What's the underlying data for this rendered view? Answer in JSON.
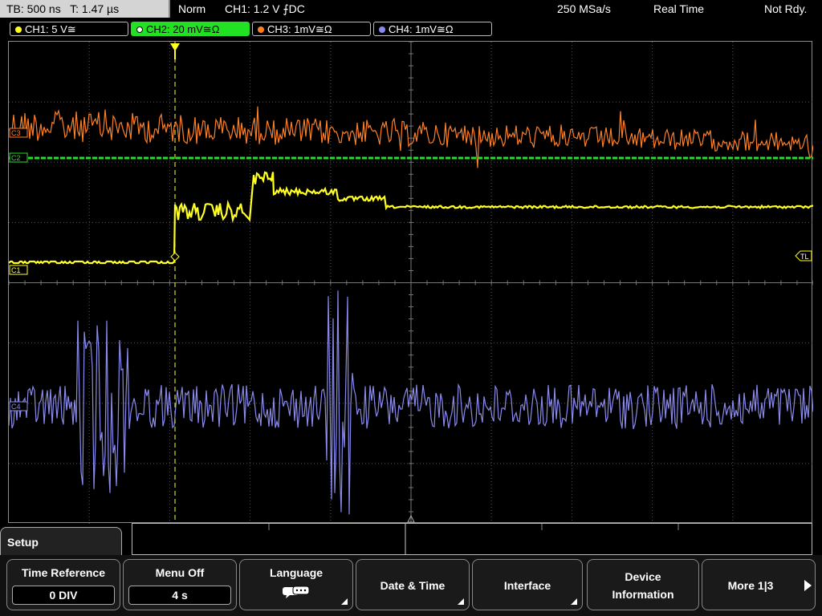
{
  "status": {
    "timebase": "TB: 500 ns",
    "trigger_time": "T: 1.47 µs",
    "mode": "Norm",
    "trigger": "CH1: 1.2 V ⨍DC",
    "sample_rate": "250 MSa/s",
    "acq_mode": "Real Time",
    "state": "Not Rdy."
  },
  "channels": [
    {
      "label": "CH1: 5 V≅",
      "color": "#ffff22"
    },
    {
      "label": "CH2: 20 mV≅Ω",
      "color": "#22e022"
    },
    {
      "label": "CH3: 1mV≅Ω",
      "color": "#ff7f27"
    },
    {
      "label": "CH4: 1mV≅Ω",
      "color": "#8a8aee"
    }
  ],
  "markers": {
    "c3": "C3",
    "c2": "C2",
    "c1": "C1",
    "c4": "C4",
    "trigger_level": "TL"
  },
  "menu": {
    "title": "Setup",
    "softkeys": [
      {
        "label": "Time Reference",
        "value": "0 DIV"
      },
      {
        "label": "Menu Off",
        "value": "4 s"
      },
      {
        "label": "Language",
        "icon": "speech-bubbles-icon"
      },
      {
        "label": "Date & Time"
      },
      {
        "label": "Interface"
      },
      {
        "label1": "Device",
        "label2": "Information"
      },
      {
        "label": "More 1|3"
      }
    ]
  }
}
